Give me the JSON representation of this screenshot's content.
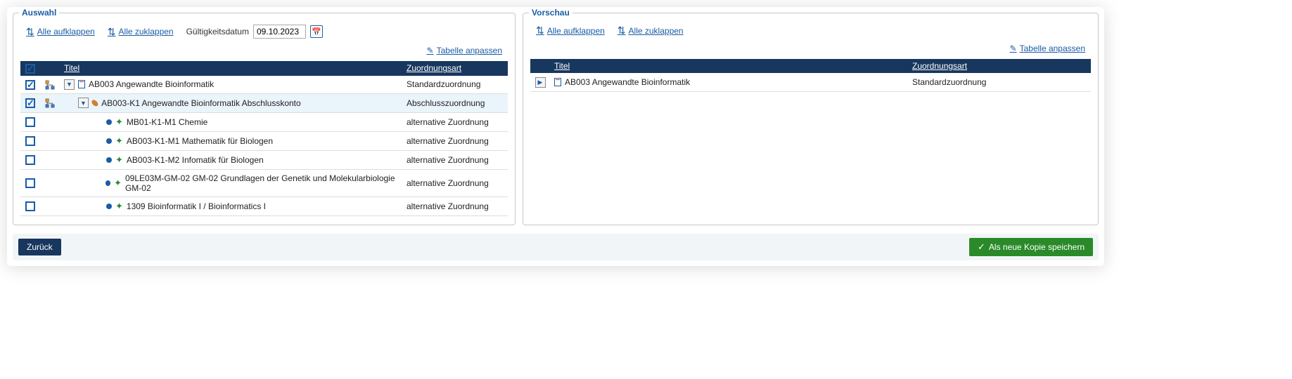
{
  "auswahl": {
    "title": "Auswahl",
    "expand_all": "Alle aufklappen",
    "collapse_all": "Alle zuklappen",
    "date_label": "Gültigkeitsdatum",
    "date_value": "09.10.2023",
    "adjust_table": "Tabelle anpassen",
    "columns": {
      "title": "Titel",
      "assignment_type": "Zuordnungsart"
    },
    "rows": [
      {
        "checked": true,
        "hierarchy": true,
        "indent": 0,
        "expandable": true,
        "expanded": true,
        "expand_dir": "down",
        "icons": [
          "doc"
        ],
        "title": "AB003 Angewandte Bioinformatik",
        "type": "Standardzuordnung",
        "selected": false
      },
      {
        "checked": true,
        "hierarchy": true,
        "indent": 1,
        "expandable": true,
        "expanded": true,
        "expand_dir": "down",
        "icons": [
          "pill"
        ],
        "title": "AB003-K1 Angewandte Bioinformatik Abschlusskonto",
        "type": "Abschlusszuordnung",
        "selected": true
      },
      {
        "checked": false,
        "hierarchy": false,
        "indent": 2,
        "expandable": false,
        "icons": [
          "dot",
          "puzzle"
        ],
        "title": "MB01-K1-M1 Chemie",
        "type": "alternative Zuordnung"
      },
      {
        "checked": false,
        "hierarchy": false,
        "indent": 2,
        "expandable": false,
        "icons": [
          "dot",
          "puzzle"
        ],
        "title": "AB003-K1-M1 Mathematik für Biologen",
        "type": "alternative Zuordnung"
      },
      {
        "checked": false,
        "hierarchy": false,
        "indent": 2,
        "expandable": false,
        "icons": [
          "dot",
          "puzzle"
        ],
        "title": "AB003-K1-M2 Infomatik für Biologen",
        "type": "alternative Zuordnung"
      },
      {
        "checked": false,
        "hierarchy": false,
        "indent": 2,
        "expandable": false,
        "icons": [
          "dot",
          "puzzle"
        ],
        "title": "09LE03M-GM-02 GM-02 Grundlagen der Genetik und Molekularbiologie GM-02",
        "type": "alternative Zuordnung"
      },
      {
        "checked": false,
        "hierarchy": false,
        "indent": 2,
        "expandable": false,
        "icons": [
          "dot",
          "puzzle"
        ],
        "title": "1309 Bioinformatik I / Bioinformatics I",
        "type": "alternative Zuordnung"
      }
    ]
  },
  "vorschau": {
    "title": "Vorschau",
    "expand_all": "Alle aufklappen",
    "collapse_all": "Alle zuklappen",
    "adjust_table": "Tabelle anpassen",
    "columns": {
      "title": "Titel",
      "assignment_type": "Zuordnungsart"
    },
    "rows": [
      {
        "expandable": true,
        "expanded": false,
        "expand_dir": "right",
        "icons": [
          "doc"
        ],
        "title": "AB003 Angewandte Bioinformatik",
        "type": "Standardzuordnung"
      }
    ]
  },
  "footer": {
    "back": "Zurück",
    "save_copy": "Als neue Kopie speichern"
  }
}
